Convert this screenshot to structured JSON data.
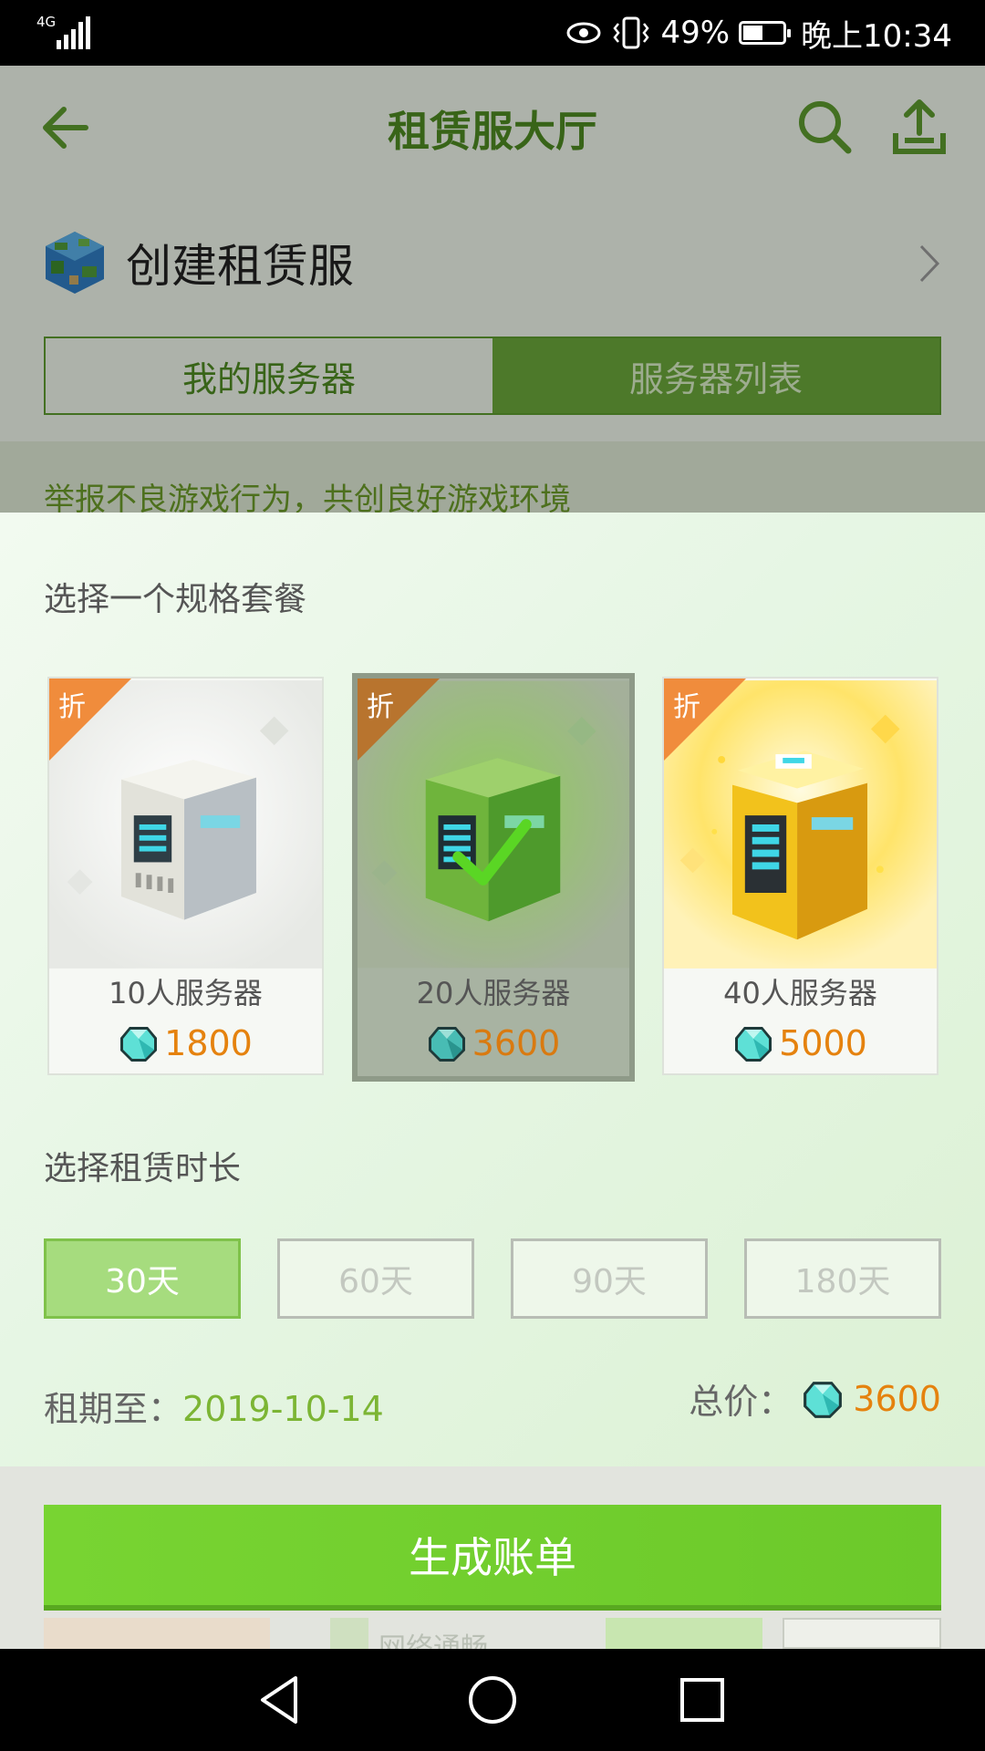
{
  "status_bar": {
    "network": "4G",
    "battery_percent": "49%",
    "battery_level": 0.49,
    "time": "晚上10:34",
    "icons": [
      "signal-icon",
      "eye-icon",
      "vibrate-icon",
      "battery-icon"
    ]
  },
  "header": {
    "title": "租赁服大厅",
    "icons": [
      "back-arrow-icon",
      "search-icon",
      "share-icon"
    ]
  },
  "create": {
    "label": "创建租赁服",
    "icons": [
      "globe-icon",
      "chevron-right-icon"
    ]
  },
  "tabs": [
    {
      "label": "我的服务器",
      "active": false
    },
    {
      "label": "服务器列表",
      "active": true
    }
  ],
  "notice": {
    "text": "举报不良游戏行为，共创良好游戏环境"
  },
  "sheet": {
    "package_title": "选择一个规格套餐",
    "packages": [
      {
        "name": "10人服务器",
        "price": "1800",
        "tag": "折",
        "selected": false
      },
      {
        "name": "20人服务器",
        "price": "3600",
        "tag": "折",
        "selected": true
      },
      {
        "name": "40人服务器",
        "price": "5000",
        "tag": "折",
        "selected": false
      }
    ],
    "duration_title": "选择租赁时长",
    "durations": [
      {
        "label": "30天",
        "active": true
      },
      {
        "label": "60天",
        "active": false
      },
      {
        "label": "90天",
        "active": false
      },
      {
        "label": "180天",
        "active": false
      }
    ],
    "lease_label": "租期至：",
    "lease_date": "2019-10-14",
    "total_label": "总价：",
    "total_price": "3600",
    "generate_button": "生成账单"
  },
  "footer_peek": {
    "text": "网络通畅"
  },
  "colors": {
    "accent_green": "#6cc92a",
    "price_orange": "#e5820e",
    "header_green": "#4e8a22",
    "date_green": "#7cb534"
  }
}
